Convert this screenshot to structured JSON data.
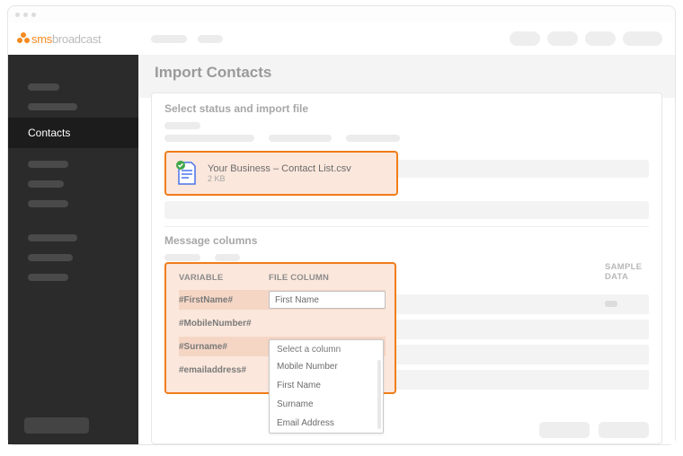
{
  "brand": {
    "name_a": "sms",
    "name_b": "broadcast"
  },
  "sidebar": {
    "active_label": "Contacts"
  },
  "page": {
    "title": "Import Contacts"
  },
  "section": {
    "upload_title": "Select status and import file",
    "columns_title": "Message columns"
  },
  "file": {
    "name": "Your Business – Contact List.csv",
    "size": "2 KB"
  },
  "mapping": {
    "header_variable": "VARIABLE",
    "header_filecol": "FILE COLUMN",
    "header_sample": "SAMPLE DATA",
    "rows": [
      {
        "variable": "#FirstName#",
        "selected": "First Name"
      },
      {
        "variable": "#MobileNumber#",
        "selected": ""
      },
      {
        "variable": "#Surname#",
        "selected": ""
      },
      {
        "variable": "#emailaddress#",
        "selected": ""
      }
    ]
  },
  "dropdown": {
    "placeholder": "Select a column",
    "options": [
      "Mobile Number",
      "First Name",
      "Surname",
      "Email Address"
    ]
  }
}
